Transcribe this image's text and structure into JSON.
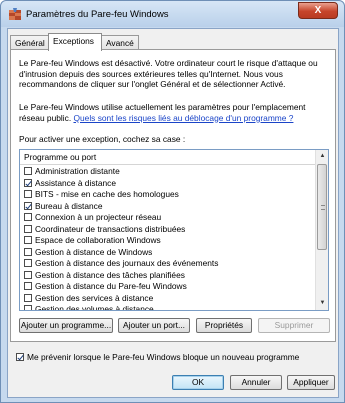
{
  "window": {
    "title": "Paramètres du Pare-feu Windows",
    "close": "X"
  },
  "tabs": [
    {
      "label": "Général",
      "active": false
    },
    {
      "label": "Exceptions",
      "active": true
    },
    {
      "label": "Avancé",
      "active": false
    }
  ],
  "panel": {
    "description": "Le Pare-feu Windows est désactivé. Votre ordinateur court le risque d'attaque ou d'intrusion depuis des sources extérieures telles qu'Internet. Nous vous recommandons de cliquer sur l'onglet Général et de sélectionner Activé.",
    "policy_text": "Le Pare-feu Windows utilise actuellement les paramètres pour l'emplacement réseau public. ",
    "policy_link": "Quels sont les risques liés au déblocage d'un programme ?",
    "instruction": "Pour activer une exception, cochez sa case :",
    "list_header": "Programme ou port",
    "items": [
      {
        "label": "Administration distante",
        "checked": false
      },
      {
        "label": "Assistance à distance",
        "checked": true
      },
      {
        "label": "BITS - mise en cache des homologues",
        "checked": false
      },
      {
        "label": "Bureau à distance",
        "checked": true
      },
      {
        "label": "Connexion à un projecteur réseau",
        "checked": false
      },
      {
        "label": "Coordinateur de transactions distribuées",
        "checked": false
      },
      {
        "label": "Espace de collaboration Windows",
        "checked": false
      },
      {
        "label": "Gestion à distance de Windows",
        "checked": false
      },
      {
        "label": "Gestion à distance des journaux des événements",
        "checked": false
      },
      {
        "label": "Gestion à distance des tâches planifiées",
        "checked": false
      },
      {
        "label": "Gestion à distance du Pare-feu Windows",
        "checked": false
      },
      {
        "label": "Gestion des services à distance",
        "checked": false
      },
      {
        "label": "Gestion des volumes à distance",
        "checked": false
      }
    ]
  },
  "buttons": {
    "add_program": "Ajouter un programme...",
    "add_port": "Ajouter un port...",
    "properties": "Propriétés",
    "delete": "Supprimer"
  },
  "notify": {
    "label": "Me prévenir lorsque le Pare-feu Windows bloque un nouveau programme",
    "checked": true
  },
  "footer": {
    "ok": "OK",
    "cancel": "Annuler",
    "apply": "Appliquer"
  },
  "colors": {
    "link": "#1a44c8",
    "frame": "#c6d9ee",
    "close": "#c7452b"
  }
}
